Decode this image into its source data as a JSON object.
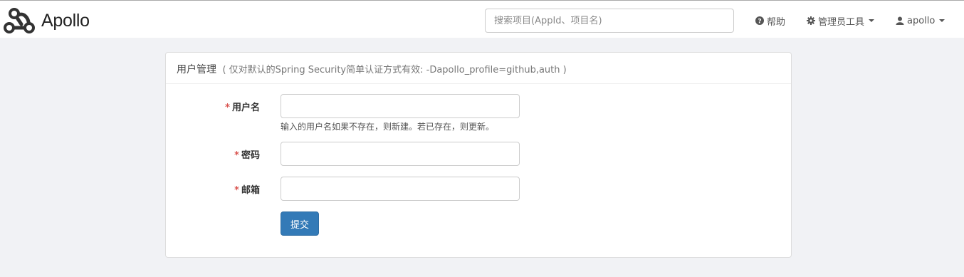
{
  "header": {
    "logo_text": "Apollo",
    "search_placeholder": "搜索项目(AppId、项目名)",
    "nav": {
      "help_label": "帮助",
      "admin_tools_label": "管理员工具",
      "user_label": "apollo"
    }
  },
  "panel": {
    "title": "用户管理",
    "hint": "( 仅对默认的Spring Security简单认证方式有效: -Dapollo_profile=github,auth )"
  },
  "form": {
    "required_mark": "*",
    "username_label": "用户名",
    "username_value": "",
    "username_help": "输入的用户名如果不存在，则新建。若已存在，则更新。",
    "password_label": "密码",
    "password_value": "",
    "email_label": "邮箱",
    "email_value": "",
    "submit_label": "提交"
  },
  "colors": {
    "primary": "#337ab7",
    "required": "#d9534f",
    "background": "#f1f2f5"
  },
  "icons": {
    "logo": "apollo-logo-icon",
    "help": "question-circle-icon",
    "admin": "gear-icon",
    "user": "user-icon",
    "dropdown": "caret-down-icon"
  }
}
